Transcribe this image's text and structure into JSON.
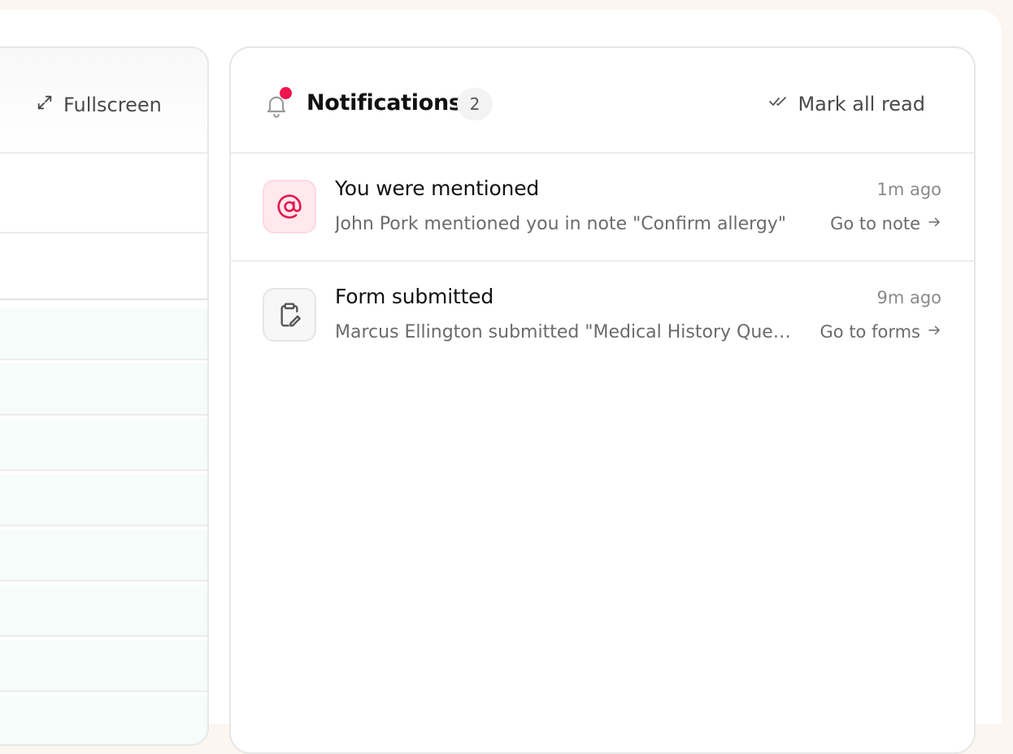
{
  "left_panel": {
    "fullscreen_label": "Fullscreen",
    "fullscreen_icon": "expand-icon"
  },
  "notifications": {
    "title": "Notifications",
    "count": "2",
    "mark_all_read_label": "Mark all read",
    "bell_icon": "bell-icon",
    "unread_dot_color": "#f0144f",
    "items": [
      {
        "icon": "at-sign-icon",
        "icon_color": "#e5194f",
        "title": "You were mentioned",
        "time": "1m ago",
        "description": "John Pork mentioned you in note \"Confirm allergy\"",
        "action_label": "Go to note"
      },
      {
        "icon": "clipboard-edit-icon",
        "icon_color": "#555555",
        "title": "Form submitted",
        "time": "9m ago",
        "description": "Marcus Ellington submitted \"Medical History Questionnaire\"",
        "action_label": "Go to forms"
      }
    ]
  }
}
